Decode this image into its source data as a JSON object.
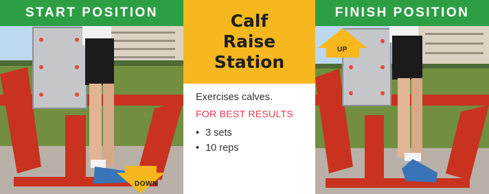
{
  "start": {
    "header": "START POSITION",
    "arrow_label": "DOWN"
  },
  "finish": {
    "header": "FINISH POSITION",
    "arrow_label": "UP"
  },
  "center": {
    "title_lines": [
      "Calf",
      "Raise",
      "Station"
    ],
    "description": "Exercises calves.",
    "best_results": "FOR BEST RESULTS",
    "bullets": [
      "3 sets",
      "10 reps"
    ]
  },
  "colors": {
    "header_green": "#2e9e45",
    "title_yellow": "#f7b71e",
    "accent_red": "#e23a4e",
    "equipment_red": "#c8321f",
    "arrow_yellow": "#f7b71e"
  }
}
